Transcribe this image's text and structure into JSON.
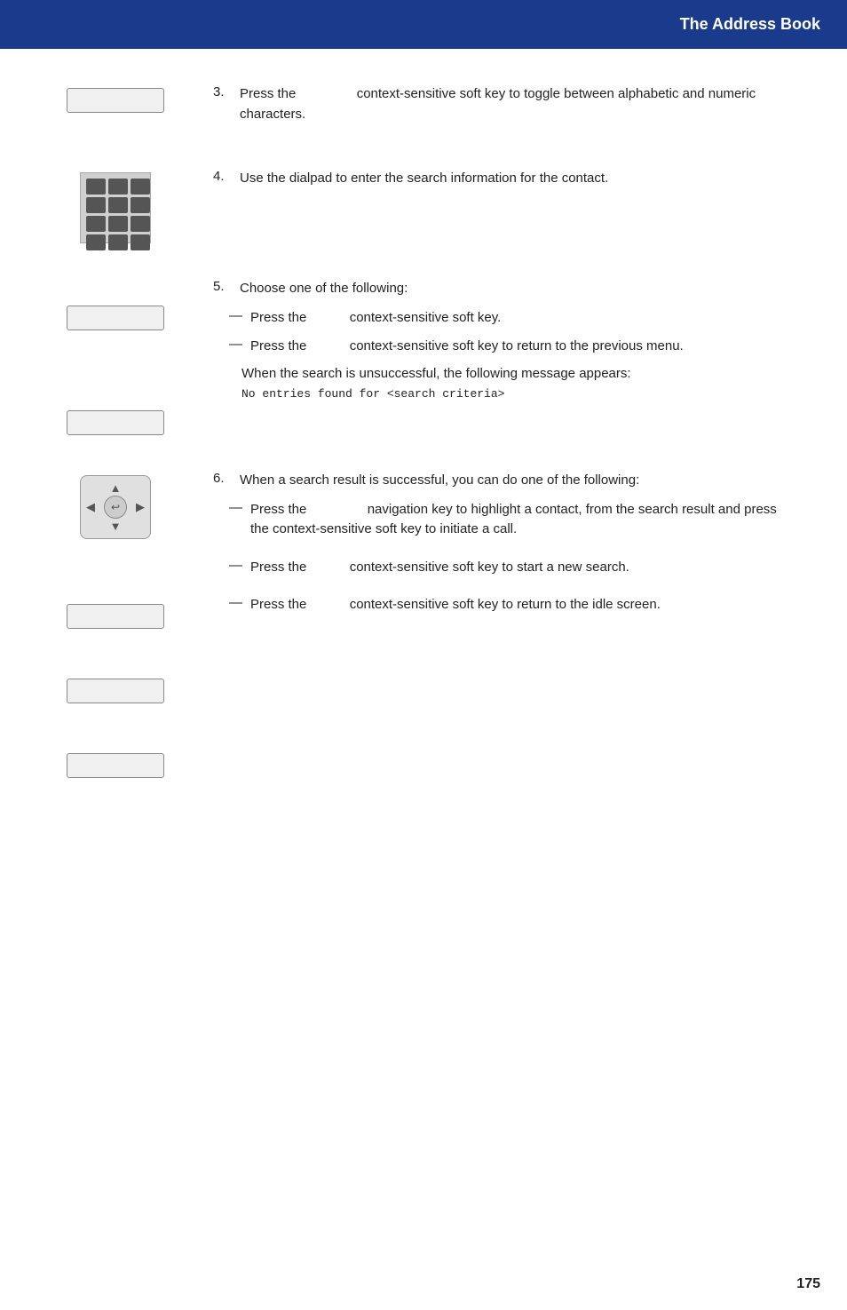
{
  "header": {
    "title": "The Address Book",
    "bg_color": "#1a3a8c"
  },
  "steps": [
    {
      "number": "3.",
      "text": "Press the         context-sensitive soft key to toggle between alphabetic and numeric characters.",
      "icon_type": "softkey",
      "bullets": []
    },
    {
      "number": "4.",
      "text": "Use the dialpad to enter the search information for the contact.",
      "icon_type": "dialpad",
      "bullets": []
    },
    {
      "number": "5.",
      "text": "Choose one of the following:",
      "icon_type": "softkey_pair",
      "bullets": [
        {
          "dash": "—",
          "text": "Press the         context-sensitive soft key."
        },
        {
          "dash": "—",
          "text": "Press the         context-sensitive soft key to return to the previous menu."
        }
      ],
      "note": "When the search is unsuccessful, the following message appears:",
      "code": "No entries found for <search criteria>"
    },
    {
      "number": "6.",
      "text": "When a search result is successful, you can do one of the following:",
      "icon_type": "navkey_softkeys",
      "bullets": [
        {
          "dash": "—",
          "text": "Press the              navigation key to highlight a contact, from the search result and press the context-sensitive soft key to initiate a call."
        },
        {
          "dash": "—",
          "text": "Press the         context-sensitive soft key to start a new search."
        },
        {
          "dash": "—",
          "text": "Press the         context-sensitive soft key to return to the idle screen."
        }
      ]
    }
  ],
  "footer": {
    "page_number": "175"
  }
}
